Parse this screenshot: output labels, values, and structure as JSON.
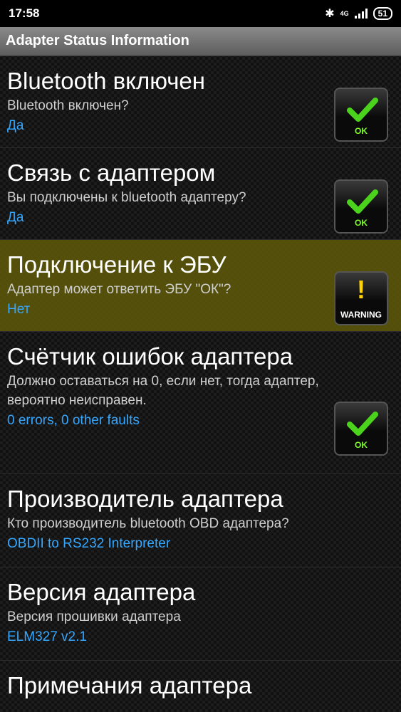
{
  "status_bar": {
    "time": "17:58",
    "network": "4G",
    "battery": "51"
  },
  "app": {
    "title": "Adapter Status Information"
  },
  "items": [
    {
      "title": "Bluetooth включен",
      "desc": "Bluetooth включен?",
      "value": "Да",
      "badge": "OK"
    },
    {
      "title": "Связь с адаптером",
      "desc": "Вы подключены к bluetooth адаптеру?",
      "value": "Да",
      "badge": "OK"
    },
    {
      "title": "Подключение к ЭБУ",
      "desc": "Адаптер может ответить ЭБУ \"ОК\"?",
      "value": "Нет",
      "badge": "WARNING"
    },
    {
      "title": "Счётчик ошибок адаптера",
      "desc": "Должно оставаться на 0, если нет, тогда адаптер, вероятно неисправен.",
      "value": "0 errors, 0 other faults",
      "badge": "OK"
    },
    {
      "title": "Производитель адаптера",
      "desc": "Кто производитель bluetooth OBD адаптера?",
      "value": "OBDII to RS232 Interpreter"
    },
    {
      "title": "Версия адаптера",
      "desc": "Версия прошивки адаптера",
      "value": "ELM327 v2.1"
    },
    {
      "title": "Примечания адаптера"
    }
  ],
  "colors": {
    "value": "#35a7ff",
    "ok_check": "#4bd21c",
    "warning_row": "#5f5a0a",
    "warning_icon": "#ffd200"
  }
}
